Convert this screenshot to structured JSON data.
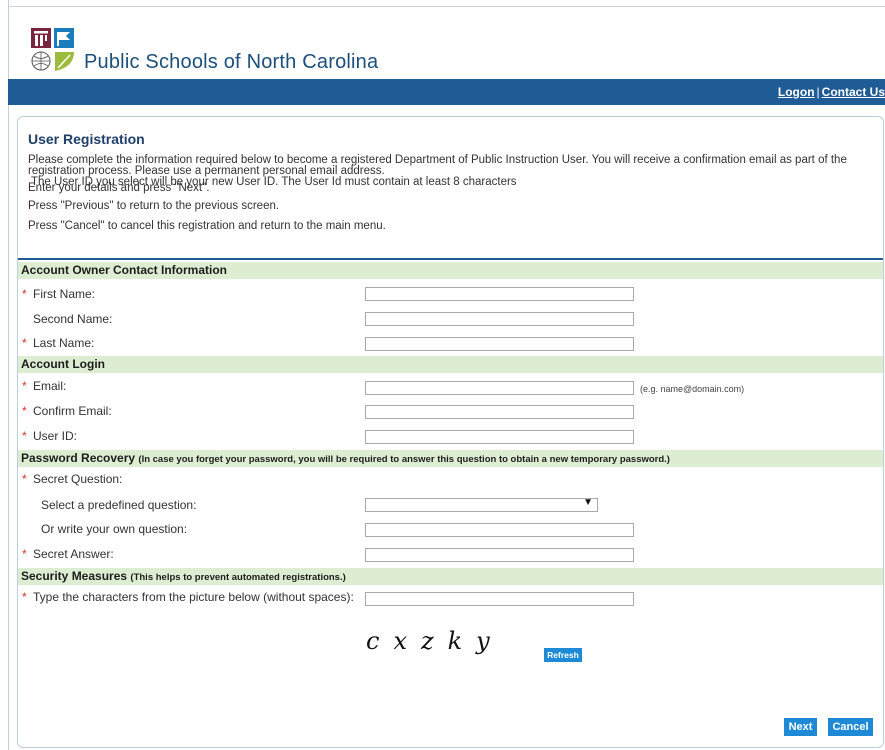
{
  "header": {
    "site_title": "Public Schools of North Carolina",
    "logon_link": "Logon",
    "separator": "|",
    "contact_link": "Contact Us"
  },
  "intro": {
    "title": "User Registration",
    "p1": "Please complete the information required below to become a registered Department of Public Instruction User. You will receive a confirmation email as part of the registration process. Please use a permanent personal email address.",
    "p1b": "The User ID you select will be your new User ID. The User Id must contain at least 8 characters",
    "p2": "Enter your details and press \"Next\".",
    "p3": "Press \"Previous\" to return to the previous screen.",
    "p4": "Press \"Cancel\" to cancel this registration and return to the main menu."
  },
  "sections": {
    "contact": {
      "title": "Account Owner Contact Information"
    },
    "login": {
      "title": "Account Login"
    },
    "recovery": {
      "title": "Password Recovery",
      "note": "(In case you forget your password, you will be required to answer this question to obtain a new temporary password.)"
    },
    "security": {
      "title": "Security Measures",
      "note": "(This helps to prevent automated registrations.)"
    }
  },
  "fields": {
    "first_name": {
      "label": "First Name:",
      "value": ""
    },
    "second_name": {
      "label": "Second Name:",
      "value": ""
    },
    "last_name": {
      "label": "Last Name:",
      "value": ""
    },
    "email": {
      "label": "Email:",
      "value": "",
      "hint": "(e.g. name@domain.com)"
    },
    "confirm_email": {
      "label": "Confirm Email:",
      "value": ""
    },
    "user_id": {
      "label": "User ID:",
      "value": ""
    },
    "secret_question": {
      "label": "Secret Question:"
    },
    "predefined_question": {
      "label": "Select a predefined question:",
      "selected": ""
    },
    "own_question": {
      "label": "Or write your own question:",
      "value": ""
    },
    "secret_answer": {
      "label": "Secret Answer:",
      "value": ""
    },
    "captcha_input": {
      "label": "Type the characters from the picture below (without spaces):",
      "value": ""
    }
  },
  "required_mark": "*",
  "captcha": {
    "text": "cxzky"
  },
  "buttons": {
    "refresh": "Refresh",
    "next": "Next",
    "cancel": "Cancel"
  },
  "colors": {
    "navbar": "#1f5b94",
    "section_bg": "#ddedd2",
    "button": "#1e8ad6",
    "required": "#dd3333"
  }
}
